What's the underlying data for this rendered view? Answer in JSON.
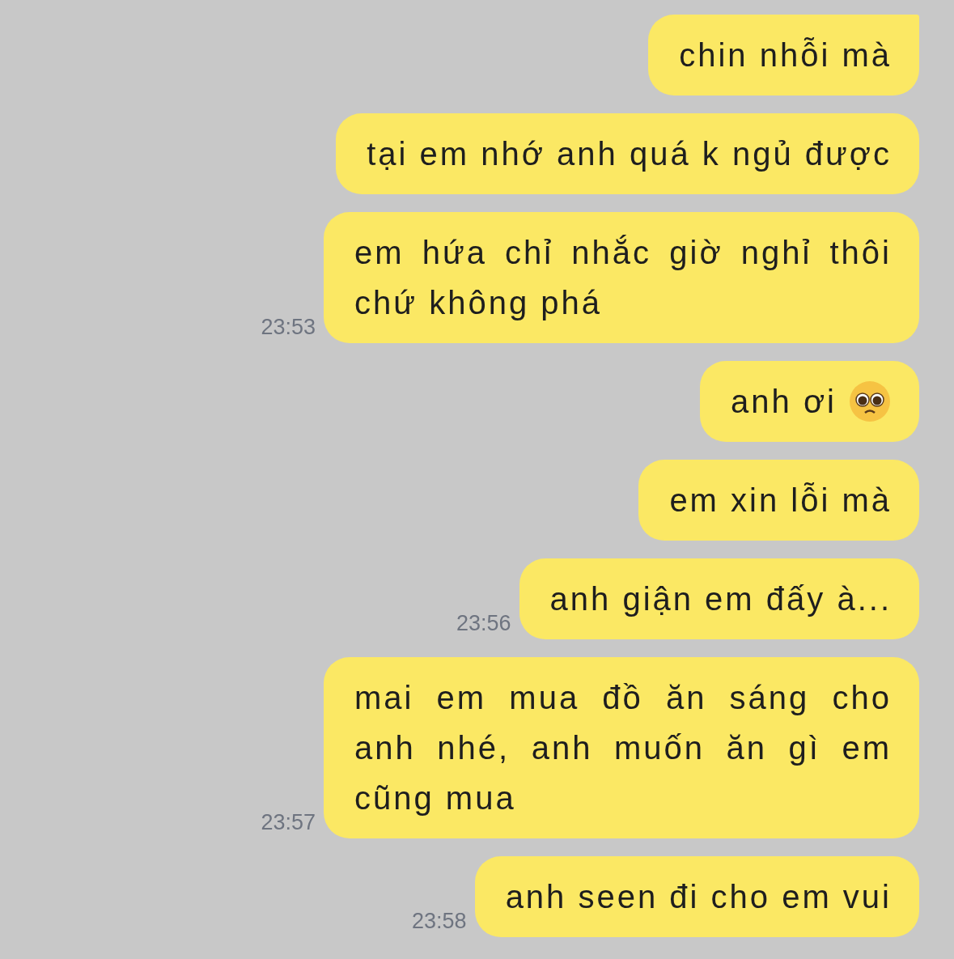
{
  "messages": [
    {
      "text": "chin nhỗi mà",
      "tail": true
    },
    {
      "text": "tại em nhớ anh quá k ngủ được"
    },
    {
      "text": "em hứa chỉ nhắc giờ nghỉ thôi chứ không phá",
      "time": "23:53"
    },
    {
      "text": "anh ơi",
      "trailing_icon": true
    },
    {
      "text": "em xin lỗi mà"
    },
    {
      "text": "anh giận em đấy à...",
      "time": "23:56"
    },
    {
      "text": "mai em mua đồ ăn sáng cho anh nhé, anh muốn ăn gì em cũng mua",
      "time": "23:57"
    },
    {
      "text": "anh seen đi cho em vui",
      "time": "23:58"
    }
  ]
}
